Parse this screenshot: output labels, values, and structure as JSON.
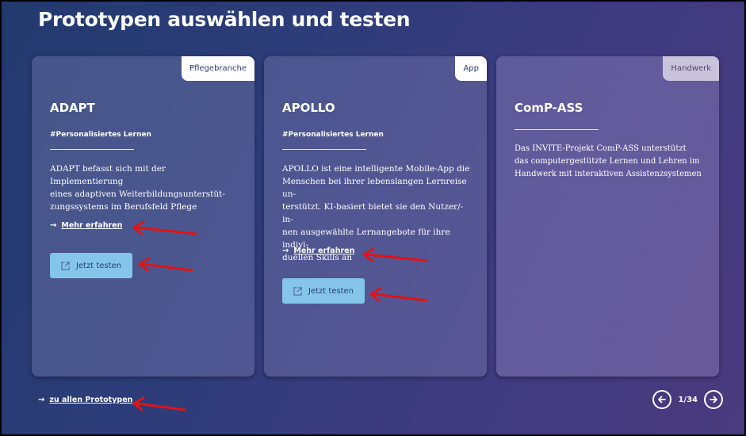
{
  "page": {
    "title": "Prototypen auswählen und testen"
  },
  "cards": [
    {
      "badge": "Pflegebranche",
      "title": "ADAPT",
      "tag": "#Personalisiertes Lernen",
      "description_lines": [
        "ADAPT befasst sich mit der Implementierung",
        "eines adaptiven Weiterbildungsunterstüt-",
        "zungssystems im Berufsfeld Pflege"
      ],
      "more_label": "Mehr erfahren",
      "test_label": "Jetzt testen"
    },
    {
      "badge": "App",
      "title": "APOLLO",
      "tag": "#Personalisiertes Lernen",
      "description_lines": [
        "APOLLO ist eine intelligente Mobile-App die",
        "Menschen bei ihrer lebenslangen Lernreise un-",
        "terstützt. KI-basiert bietet sie den Nutzer/-in-",
        "nen ausgewählte Lernangebote für ihre indivi-",
        "duellen Skills an"
      ],
      "more_label": "Mehr erfahren",
      "test_label": "Jetzt testen"
    },
    {
      "badge": "Handwerk",
      "title": "ComP-ASS",
      "description_lines": [
        "Das INVITE-Projekt ComP-ASS unterstützt",
        "das computergestützte Lernen und Lehren im",
        "Handwerk mit interaktiven Assistenzsystemen"
      ]
    }
  ],
  "footer": {
    "all_link": "zu allen Prototypen",
    "pager": "1/34"
  },
  "icons": {
    "link_arrow": "arrow-right-icon",
    "external": "external-link-icon",
    "prev": "chevron-left-circle-icon",
    "next": "chevron-right-circle-icon",
    "annotation": "red-annotation-arrow"
  },
  "colors": {
    "button_bg": "#86c5ea",
    "annotation_red": "#e01414"
  }
}
